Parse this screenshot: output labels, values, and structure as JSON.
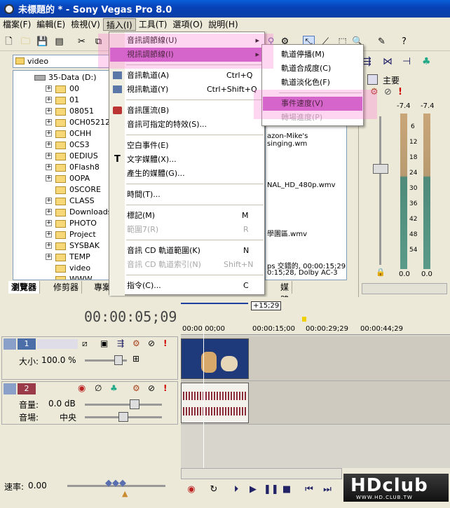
{
  "window": {
    "title": "未標題的 * - Sony Vegas Pro 8.0"
  },
  "menubar": [
    {
      "label": "檔案(F)"
    },
    {
      "label": "編輯(E)"
    },
    {
      "label": "檢視(V)"
    },
    {
      "label": "插入(I)"
    },
    {
      "label": "工具(T)"
    },
    {
      "label": "選項(O)"
    },
    {
      "label": "說明(H)"
    }
  ],
  "explorer": {
    "path": "video",
    "drive": "35-Data (D:)",
    "folders": [
      "00",
      "01",
      "08051",
      "0CH05212",
      "0CHH",
      "0CS3",
      "0EDIUS",
      "0Flash8",
      "0OPA",
      "0SCORE",
      "CLASS",
      "Downloads",
      "PHOTO",
      "Project",
      "SYSBAK",
      "TEMP",
      "video",
      "WWW"
    ]
  },
  "file_list": {
    "items": [
      "azon-Mike's singing.wm",
      "NAL_HD_480p.wmv",
      "學園區.wmv"
    ],
    "info_line1": "ps 交錯的, 00:00:15;29",
    "info_line2": "0:15;28, Dolby AC-3"
  },
  "tabs_left": [
    "瀏覽器",
    "修剪器",
    "專案"
  ],
  "tabs_right": [
    "媒體產生器"
  ],
  "insert_menu": {
    "items": [
      {
        "label": "音訊調節線(U)",
        "shortcut": "",
        "submenu": true,
        "state": "normal"
      },
      {
        "label": "視訊調節線(I)",
        "shortcut": "",
        "submenu": true,
        "state": "highlighted"
      },
      {
        "label": "音訊軌道(A)",
        "shortcut": "Ctrl+Q",
        "state": "normal"
      },
      {
        "label": "視訊軌道(Y)",
        "shortcut": "Ctrl+Shift+Q",
        "state": "normal"
      },
      {
        "label": "音訊匯流(B)",
        "shortcut": "",
        "state": "normal"
      },
      {
        "label": "音訊可指定的特效(S)...",
        "shortcut": "",
        "state": "normal"
      },
      {
        "label": "空白事件(E)",
        "shortcut": "",
        "state": "normal"
      },
      {
        "label": "文字媒體(X)...",
        "shortcut": "",
        "state": "normal"
      },
      {
        "label": "產生的媒體(G)...",
        "shortcut": "",
        "state": "normal"
      },
      {
        "label": "時間(T)...",
        "shortcut": "",
        "state": "normal"
      },
      {
        "label": "標記(M)",
        "shortcut": "M",
        "state": "normal"
      },
      {
        "label": "範圍7(R)",
        "shortcut": "R",
        "state": "disabled"
      },
      {
        "label": "音訊 CD 軌道範圍(K)",
        "shortcut": "N",
        "state": "normal"
      },
      {
        "label": "音訊 CD 軌道索引(N)",
        "shortcut": "Shift+N",
        "state": "disabled"
      },
      {
        "label": "指令(C)...",
        "shortcut": "C",
        "state": "normal"
      }
    ]
  },
  "envelope_submenu": {
    "items": [
      {
        "label": "軌道停播(M)",
        "state": "normal"
      },
      {
        "label": "軌道合成度(C)",
        "state": "normal"
      },
      {
        "label": "軌道淡化色(F)",
        "state": "normal"
      },
      {
        "label": "事件速度(V)",
        "state": "highlighted"
      },
      {
        "label": "轉場進度(P)",
        "state": "disabled"
      }
    ]
  },
  "mixer": {
    "label": "主要",
    "meter_left": "-7.4",
    "meter_right": "-7.4",
    "scale": [
      "6",
      "12",
      "18",
      "24",
      "30",
      "36",
      "42",
      "48",
      "54"
    ],
    "val_left": "0.0",
    "val_right": "0.0"
  },
  "timeline": {
    "timecode": "00:00:05;09",
    "loop_end": "+15;29",
    "ruler": [
      "00:00:00;00",
      "00:00:15;00",
      "00:00:29;29",
      "00:00:44;29"
    ],
    "video_track": {
      "number": "1",
      "size_label": "大小:",
      "size_value": "100.0 %"
    },
    "audio_track": {
      "number": "2",
      "volume_label": "音量:",
      "volume_value": "0.0 dB",
      "pan_label": "音場:",
      "pan_value": "中央"
    },
    "rate_label": "速率:",
    "rate_value": "0.00"
  },
  "watermark": {
    "text": "HDclub",
    "site": "WWW.HD.CLUB.TW"
  },
  "colors": {
    "menu_highlight": "#c35ec9",
    "titlebar": "#0842b8"
  }
}
